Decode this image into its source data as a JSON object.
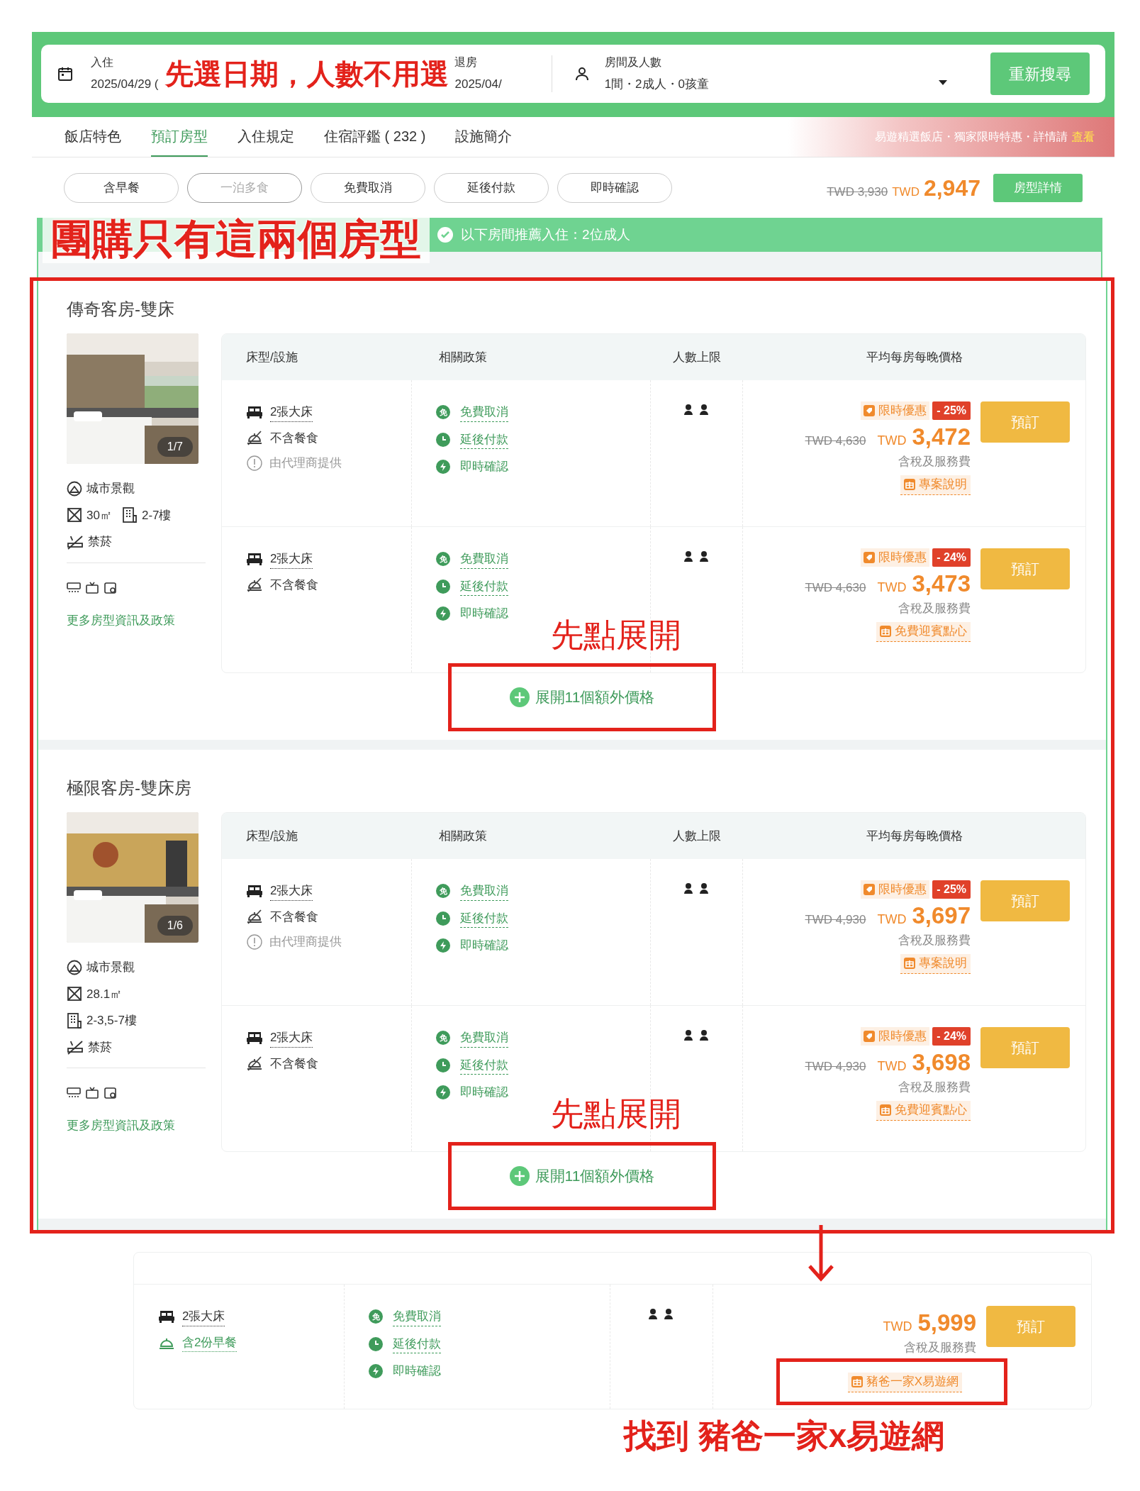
{
  "search_bar": {
    "check_in": {
      "label": "入住",
      "value": "2025/04/29 ("
    },
    "annotation": "先選日期，人數不用選",
    "check_out": {
      "label": "退房",
      "value": "2025/04/"
    },
    "guests": {
      "label": "房間及人數",
      "value": "1間・2成人・0孩童"
    },
    "search_button": "重新搜尋"
  },
  "nav_tabs": [
    {
      "label": "飯店特色",
      "selected": false
    },
    {
      "label": "預訂房型",
      "selected": true
    },
    {
      "label": "入住規定",
      "selected": false
    },
    {
      "label": "住宿評鑑 ( 232 )",
      "selected": false
    },
    {
      "label": "設施簡介",
      "selected": false
    }
  ],
  "promo_banner": {
    "text": "易遊精選飯店・獨家限時特惠・詳情請",
    "link": "查看"
  },
  "filters": [
    {
      "label": "含早餐",
      "disabled": false
    },
    {
      "label": "一泊多食",
      "disabled": true
    },
    {
      "label": "免費取消",
      "disabled": false
    },
    {
      "label": "延後付款",
      "disabled": false
    },
    {
      "label": "即時確認",
      "disabled": false
    }
  ],
  "summary_price": {
    "original": "TWD 3,930",
    "currency": "TWD",
    "price": "2,947",
    "button": "房型詳情"
  },
  "recommendation": {
    "annotation": "團購只有這兩個房型",
    "text": "以下房間推薦入住：2位成人"
  },
  "rooms": [
    {
      "name": "傳奇客房-雙床",
      "photo_counter": "1/7",
      "feature_rows": [
        [
          {
            "kind": "view",
            "text": "城市景觀"
          }
        ],
        [
          {
            "kind": "area",
            "text": "30㎡"
          },
          {
            "kind": "floor",
            "text": "2-7樓"
          }
        ],
        [
          {
            "kind": "no-smoking",
            "text": "禁菸"
          }
        ]
      ],
      "more_link": "更多房型資訊及政策",
      "columns": [
        "床型/設施",
        "相關政策",
        "人數上限",
        "平均每房每晚價格"
      ],
      "offers": [
        {
          "bed": "2張大床",
          "meal": {
            "text": "不含餐食",
            "included": false
          },
          "agent_note": "由代理商提供",
          "policies": [
            {
              "kind": "free-cancel",
              "icon_text": "免",
              "text": "免費取消"
            },
            {
              "kind": "pay-later",
              "text": "延後付款"
            },
            {
              "kind": "instant",
              "text": "即時確認"
            }
          ],
          "deal": {
            "label": "限時優惠",
            "discount": "- 25%"
          },
          "original": "TWD 4,630",
          "currency": "TWD",
          "price": "3,472",
          "tax_note": "含稅及服務費",
          "package": "專案說明",
          "book": "預訂"
        },
        {
          "bed": "2張大床",
          "meal": {
            "text": "不含餐食",
            "included": false
          },
          "policies": [
            {
              "kind": "free-cancel",
              "icon_text": "免",
              "text": "免費取消"
            },
            {
              "kind": "pay-later",
              "text": "延後付款"
            },
            {
              "kind": "instant",
              "text": "即時確認"
            }
          ],
          "deal": {
            "label": "限時優惠",
            "discount": "- 24%"
          },
          "original": "TWD 4,630",
          "currency": "TWD",
          "price": "3,473",
          "tax_note": "含稅及服務費",
          "package": "免費迎賓點心",
          "book": "預訂"
        }
      ],
      "annotation": "先點展開",
      "expand": "展開11個額外價格"
    },
    {
      "name": "極限客房-雙床房",
      "photo_counter": "1/6",
      "feature_rows": [
        [
          {
            "kind": "view",
            "text": "城市景觀"
          }
        ],
        [
          {
            "kind": "area",
            "text": "28.1㎡"
          }
        ],
        [
          {
            "kind": "floor",
            "text": "2-3,5-7樓"
          }
        ],
        [
          {
            "kind": "no-smoking",
            "text": "禁菸"
          }
        ]
      ],
      "more_link": "更多房型資訊及政策",
      "columns": [
        "床型/設施",
        "相關政策",
        "人數上限",
        "平均每房每晚價格"
      ],
      "offers": [
        {
          "bed": "2張大床",
          "meal": {
            "text": "不含餐食",
            "included": false
          },
          "agent_note": "由代理商提供",
          "policies": [
            {
              "kind": "free-cancel",
              "icon_text": "免",
              "text": "免費取消"
            },
            {
              "kind": "pay-later",
              "text": "延後付款"
            },
            {
              "kind": "instant",
              "text": "即時確認"
            }
          ],
          "deal": {
            "label": "限時優惠",
            "discount": "- 25%"
          },
          "original": "TWD 4,930",
          "currency": "TWD",
          "price": "3,697",
          "tax_note": "含稅及服務費",
          "package": "專案說明",
          "book": "預訂"
        },
        {
          "bed": "2張大床",
          "meal": {
            "text": "不含餐食",
            "included": false
          },
          "policies": [
            {
              "kind": "free-cancel",
              "icon_text": "免",
              "text": "免費取消"
            },
            {
              "kind": "pay-later",
              "text": "延後付款"
            },
            {
              "kind": "instant",
              "text": "即時確認"
            }
          ],
          "deal": {
            "label": "限時優惠",
            "discount": "- 24%"
          },
          "original": "TWD 4,930",
          "currency": "TWD",
          "price": "3,698",
          "tax_note": "含稅及服務費",
          "package": "免費迎賓點心",
          "book": "預訂"
        }
      ],
      "annotation": "先點展開",
      "expand": "展開11個額外價格"
    }
  ],
  "found_offer": {
    "bed": "2張大床",
    "meal": {
      "text": "含2份早餐",
      "included": true
    },
    "policies": [
      {
        "kind": "free-cancel",
        "icon_text": "免",
        "text": "免費取消"
      },
      {
        "kind": "pay-later",
        "text": "延後付款"
      },
      {
        "kind": "instant",
        "text": "即時確認"
      }
    ],
    "currency": "TWD",
    "price": "5,999",
    "tax_note": "含稅及服務費",
    "package": "豬爸一家X易遊網",
    "book": "預訂",
    "annotation": "找到 豬爸一家x易遊網"
  }
}
